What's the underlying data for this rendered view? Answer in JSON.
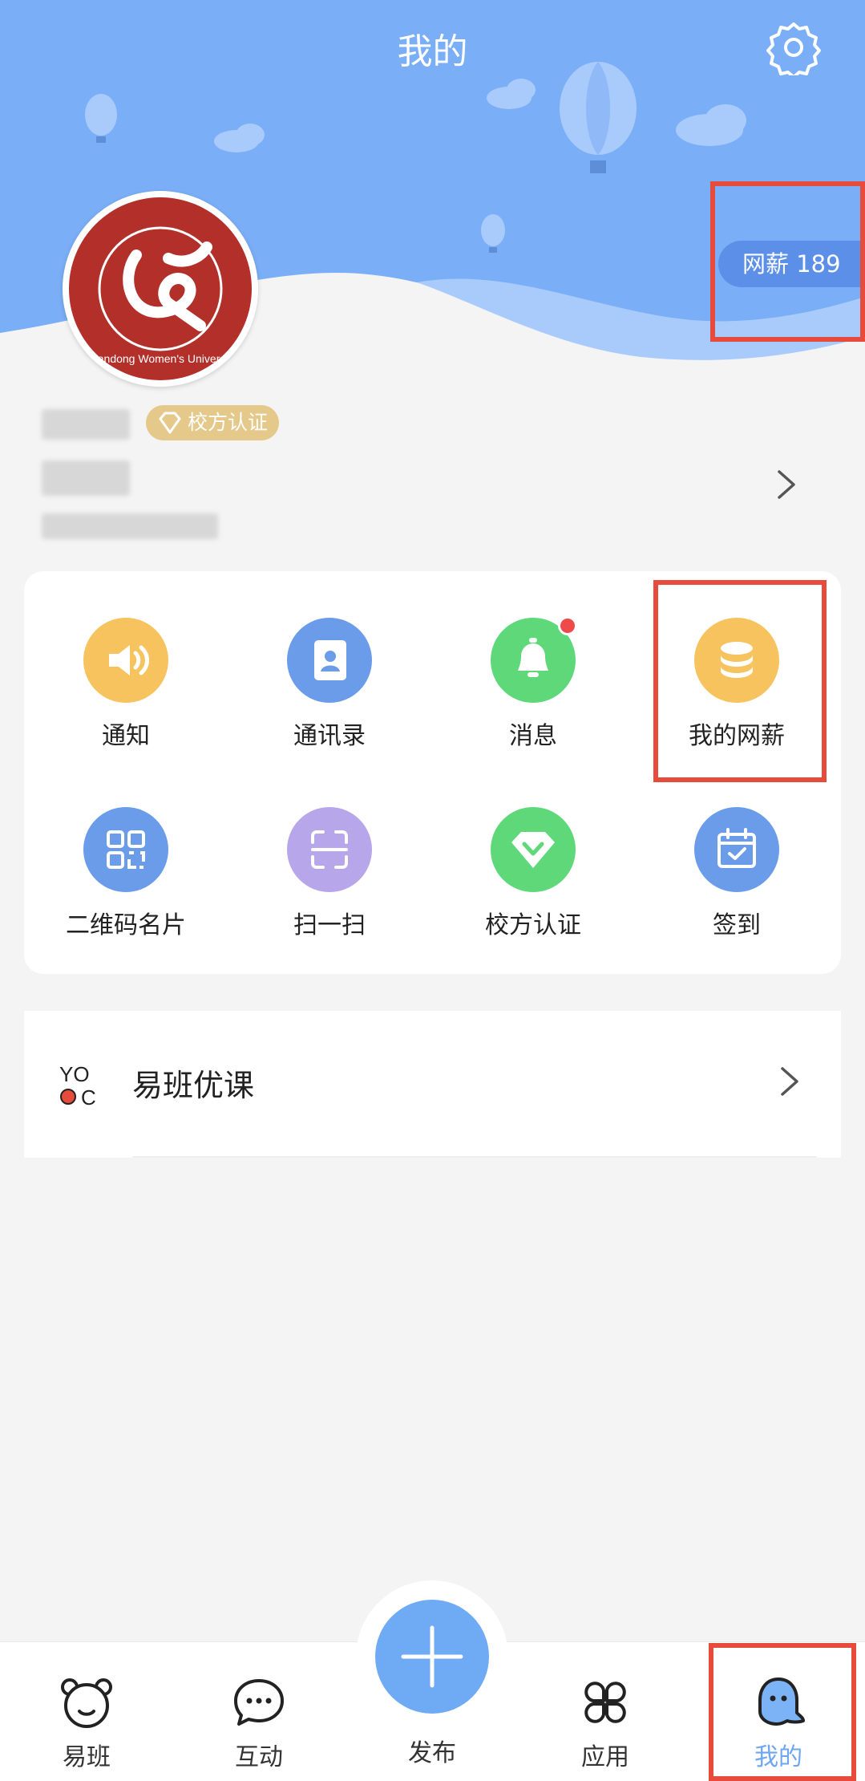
{
  "header": {
    "title": "我的",
    "settings_icon": "gear-icon",
    "bg_color": "#7aaef6"
  },
  "profile": {
    "school_seal_text": "Shandong Women's University",
    "wage_label": "网薪 189",
    "verify_badge": "校方认证"
  },
  "grid": {
    "items": [
      {
        "label": "通知",
        "icon": "speaker-icon",
        "color": "#f7c35f"
      },
      {
        "label": "通讯录",
        "icon": "contacts-icon",
        "color": "#6b9cea"
      },
      {
        "label": "消息",
        "icon": "bell-icon",
        "color": "#5fd87a"
      },
      {
        "label": "我的网薪",
        "icon": "coins-icon",
        "color": "#f7c35f"
      },
      {
        "label": "二维码名片",
        "icon": "qrcode-icon",
        "color": "#6b9cea"
      },
      {
        "label": "扫一扫",
        "icon": "scan-icon",
        "color": "#b7a6ea"
      },
      {
        "label": "校方认证",
        "icon": "verified-icon",
        "color": "#5fd87a"
      },
      {
        "label": "签到",
        "icon": "calendar-check-icon",
        "color": "#6b9cea"
      }
    ]
  },
  "course": {
    "title": "易班优课",
    "logo": "yooc-logo"
  },
  "tabbar": {
    "tabs": [
      {
        "label": "易班",
        "icon": "bear-icon"
      },
      {
        "label": "互动",
        "icon": "chat-icon"
      },
      {
        "label": "发布",
        "icon": "plus-icon"
      },
      {
        "label": "应用",
        "icon": "apps-icon"
      },
      {
        "label": "我的",
        "icon": "ghost-icon",
        "active": true
      }
    ]
  }
}
